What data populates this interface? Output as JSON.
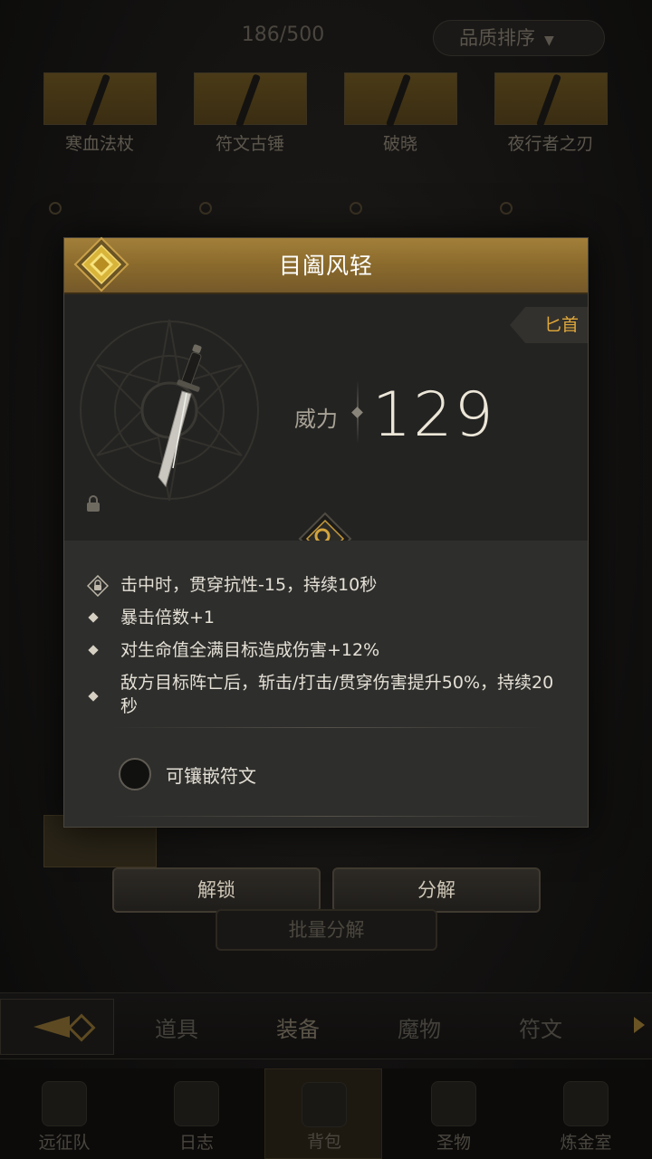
{
  "inventory": {
    "capacity": "186/500",
    "sort_label": "品质排序",
    "row1_items": [
      "寒血法杖",
      "符文古锤",
      "破晓",
      "夜行者之刃"
    ]
  },
  "modal": {
    "title": "目阖风轻",
    "weapon_type": "匕首",
    "power_label": "威力",
    "power_value": "129",
    "effects": [
      "击中时，贯穿抗性-15，持续10秒",
      "暴击倍数+1",
      "对生命值全满目标造成伤害+12%",
      "敌方目标阵亡后，斩击/打击/贯穿伤害提升50%，持续20秒"
    ],
    "rune_label": "可镶嵌符文"
  },
  "actions": {
    "unlock": "解锁",
    "decompose": "分解",
    "batch_decompose": "批量分解"
  },
  "category_tabs": [
    "道具",
    "装备",
    "魔物",
    "符文"
  ],
  "bottom_nav": [
    "远征队",
    "日志",
    "背包",
    "圣物",
    "炼金室"
  ],
  "colors": {
    "header_gold": "#9a7836",
    "weapon_type": "#e0a83a",
    "modal_bg": "#262624"
  }
}
